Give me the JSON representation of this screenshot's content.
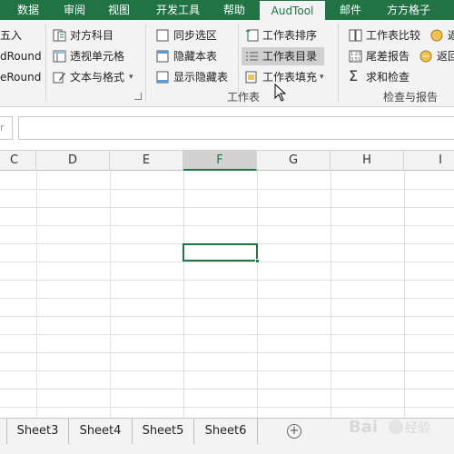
{
  "tabs": [
    "数据",
    "审阅",
    "视图",
    "开发工具",
    "帮助",
    "AudTool",
    "邮件",
    "方方格子"
  ],
  "ribbon": {
    "col1": [
      "五入",
      "dRound",
      "eRound"
    ],
    "col2": [
      "对方科目",
      "透视单元格",
      "文本与格式"
    ],
    "col3": [
      "同步选区",
      "隐藏本表",
      "显示隐藏表"
    ],
    "col4": [
      "工作表排序",
      "工作表目录",
      "工作表填充"
    ],
    "col5": [
      "工作表比较",
      "尾差报告",
      "求和检查"
    ],
    "col6": [
      "返",
      "返回"
    ],
    "group_worksheet": "工作表",
    "group_check": "检查与报告"
  },
  "namebox_fragment": "r",
  "columns": [
    "C",
    "D",
    "E",
    "F",
    "G",
    "H",
    "I"
  ],
  "selected_column": "F",
  "sheets": [
    "Sheet3",
    "Sheet4",
    "Sheet5",
    "Sheet6"
  ],
  "add_sheet": "⊕",
  "watermark": "Baidu 经验",
  "colors": {
    "accent": "#217346",
    "ribbon_bg": "#f3f3f3",
    "highlight": "#cfcfcf"
  }
}
